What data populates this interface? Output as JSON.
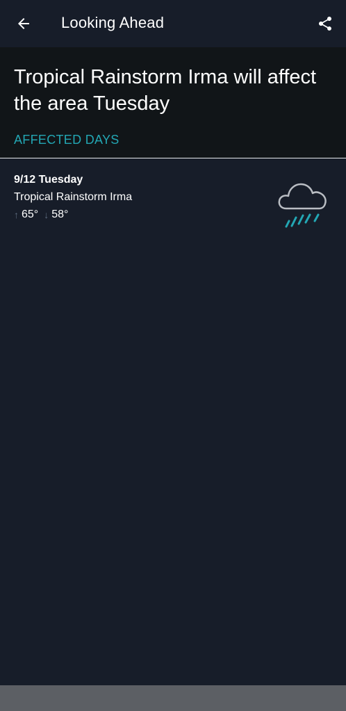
{
  "header": {
    "title": "Looking Ahead"
  },
  "alert": {
    "headline": "Tropical Rainstorm Irma will affect the area Tuesday",
    "section_label": "AFFECTED DAYS"
  },
  "days": [
    {
      "date": "9/12 Tuesday",
      "event": "Tropical Rainstorm Irma",
      "high": "65°",
      "low": "58°",
      "icon": "rain-cloud-icon"
    }
  ],
  "colors": {
    "background": "#171d29",
    "panel": "#111518",
    "accent": "#23a7b4",
    "muted_arrow": "#5d6a7d",
    "bottom_bar": "#5c5f64"
  }
}
